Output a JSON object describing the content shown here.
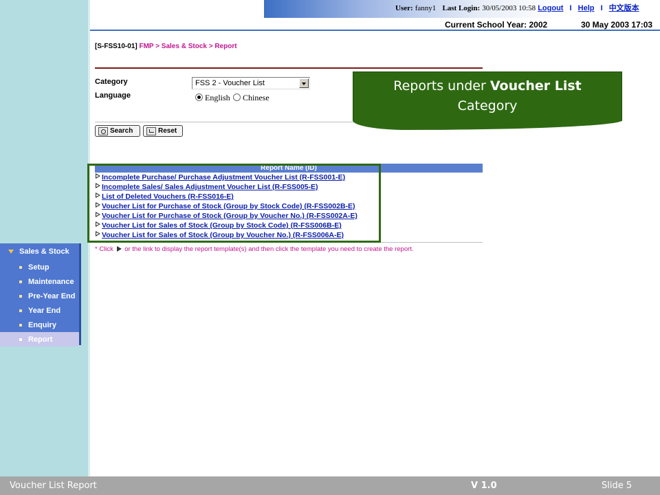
{
  "header": {
    "user_label": "User:",
    "user_value": "fanny1",
    "last_login_label": "Last Login:",
    "last_login_value": "30/05/2003 10:58",
    "logout": "Logout",
    "help": "Help",
    "chinese_version": "中文版本",
    "separator": "I",
    "school_year": "Current School Year: 2002",
    "datetime": "30 May 2003 17:03"
  },
  "breadcrumb": {
    "code": "[S-FSS10-01]",
    "path": "FMP > Sales & Stock > Report"
  },
  "form": {
    "category_label": "Category",
    "category_value": "FSS 2 - Voucher List",
    "language_label": "Language",
    "language_options": [
      "English",
      "Chinese"
    ],
    "language_selected": "English",
    "search_label": "Search",
    "reset_label": "Reset"
  },
  "callout": {
    "prefix": "Reports under ",
    "emphasis": "Voucher List",
    "suffix": "Category"
  },
  "report_table": {
    "header": "Report Name (ID)",
    "rows": [
      "Incomplete Purchase/ Purchase Adjustment Voucher List (R-FSS001-E)",
      "Incomplete Sales/ Sales Adjustment Voucher List (R-FSS005-E)",
      "List of Deleted Vouchers (R-FSS016-E)",
      "Voucher List for Purchase of Stock (Group by Stock Code) (R-FSS002B-E)",
      "Voucher List for Purchase of Stock (Group by Voucher No.) (R-FSS002A-E)",
      "Voucher List for Sales of Stock (Group by Stock Code) (R-FSS006B-E)",
      "Voucher List for Sales of Stock (Group by Voucher No.) (R-FSS006A-E)"
    ],
    "note_prefix": "* Click",
    "note_suffix": "or the link to display the report template(s) and then click the template you need to create the report."
  },
  "nav": {
    "section": "Sales & Stock",
    "items": [
      "Setup",
      "Maintenance",
      "Pre-Year End",
      "Year End",
      "Enquiry",
      "Report"
    ],
    "active": "Report"
  },
  "footer": {
    "title": "Voucher List Report",
    "version": "V 1.0",
    "slide": "Slide 5"
  },
  "colors": {
    "callout_bg": "#2e6912",
    "nav_bg": "#4f77cf",
    "link": "#0a1ea8",
    "breadcrumb_accent": "#c0178f"
  }
}
